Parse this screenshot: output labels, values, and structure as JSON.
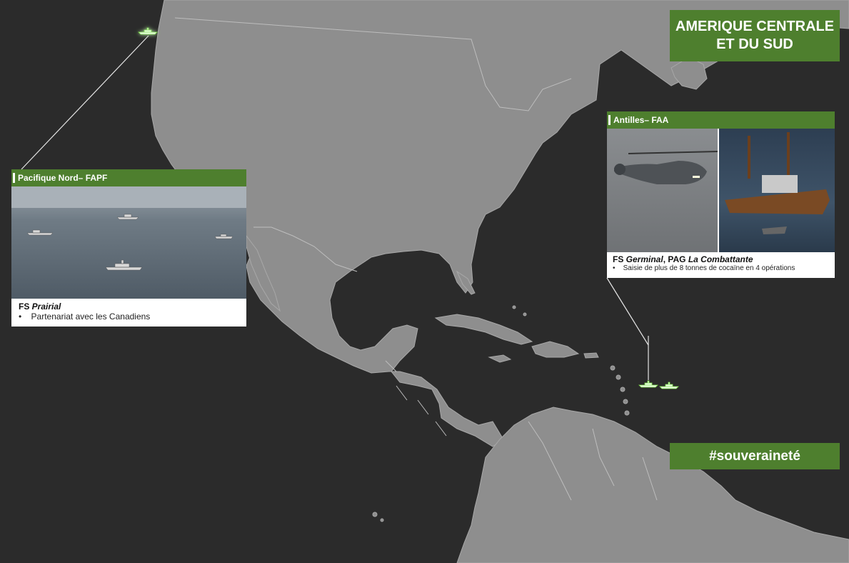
{
  "title": {
    "line1": "AMERIQUE CENTRALE",
    "line2": "ET DU SUD"
  },
  "hashtag": "#souveraineté",
  "cards": {
    "pacifique": {
      "header": "Pacifique Nord– FAPF",
      "prefix": "FS ",
      "ship": "Prairial",
      "bullet": "Partenariat avec les Canadiens"
    },
    "antilles": {
      "header": "Antilles– FAA",
      "prefix": "FS ",
      "ship1": "Germinal",
      "middle": ", PAG ",
      "ship2": "La Combattante",
      "bullet": "Saisie de plus de 8 tonnes de cocaïne en 4 opérations"
    }
  },
  "colors": {
    "background": "#2b2b2b",
    "land": "#8e8e8e",
    "accent": "#4e7f2e",
    "marker_glow": "#7fe04a"
  },
  "icons": {
    "ship_marker": "ship-icon",
    "bullet": "bullet-icon"
  }
}
